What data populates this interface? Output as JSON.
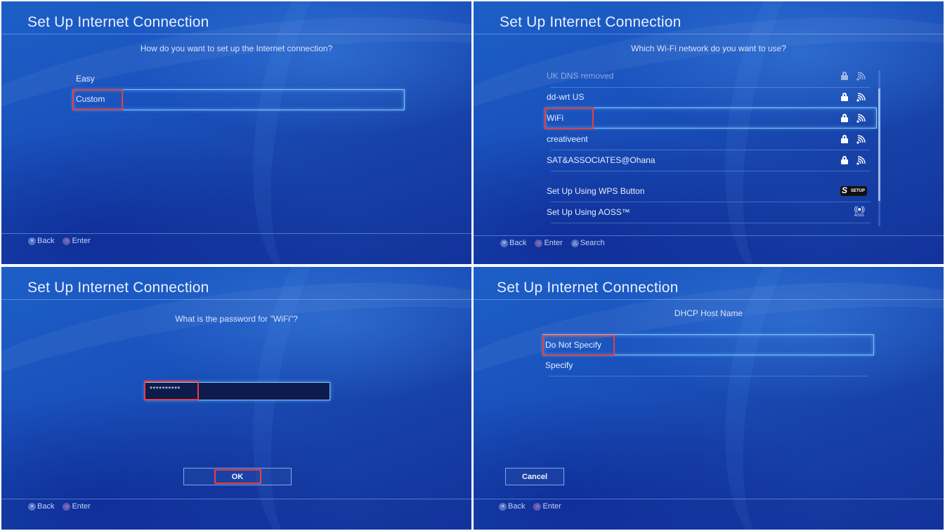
{
  "screens": [
    {
      "title": "Set Up Internet Connection",
      "prompt": "How do you want to set up the Internet connection?",
      "options": [
        {
          "label": "Easy",
          "selected": false
        },
        {
          "label": "Custom",
          "selected": true,
          "highlighted": true
        }
      ],
      "footer": [
        {
          "glyph": "cross-button-icon",
          "label": "Back"
        },
        {
          "glyph": "circle-button-icon",
          "label": "Enter"
        }
      ]
    },
    {
      "title": "Set Up Internet Connection",
      "prompt": "Which Wi-Fi network do you want to use?",
      "networks": [
        {
          "ssid": "UK DNS removed",
          "secured": true,
          "faded": true
        },
        {
          "ssid": "dd-wrt US",
          "secured": true
        },
        {
          "ssid": "WiFi",
          "secured": true,
          "selected": true,
          "highlighted": true
        },
        {
          "ssid": "creativeent",
          "secured": true
        },
        {
          "ssid": "SAT&ASSOCIATES@Ohana",
          "secured": true
        }
      ],
      "setup_options": [
        {
          "label": "Set Up Using WPS Button",
          "icon": "wps-setup-icon",
          "badge": "SETUP"
        },
        {
          "label": "Set Up Using AOSS™",
          "icon": "aoss-icon",
          "badge": "AOSS"
        }
      ],
      "footer": [
        {
          "glyph": "cross-button-icon",
          "label": "Back"
        },
        {
          "glyph": "circle-button-icon",
          "label": "Enter"
        },
        {
          "glyph": "triangle-button-icon",
          "label": "Search"
        }
      ]
    },
    {
      "title": "Set Up Internet Connection",
      "prompt": "What is the password for \"WiFi\"?",
      "password_value": "**********",
      "ok_label": "OK",
      "footer": [
        {
          "glyph": "cross-button-icon",
          "label": "Back"
        },
        {
          "glyph": "circle-button-icon",
          "label": "Enter"
        }
      ]
    },
    {
      "title": "Set Up Internet Connection",
      "prompt": "DHCP Host Name",
      "options": [
        {
          "label": "Do Not Specify",
          "selected": true,
          "highlighted": true
        },
        {
          "label": "Specify",
          "selected": false
        }
      ],
      "cancel_label": "Cancel",
      "footer": [
        {
          "glyph": "cross-button-icon",
          "label": "Back"
        },
        {
          "glyph": "circle-button-icon",
          "label": "Enter"
        }
      ]
    }
  ],
  "colors": {
    "highlight_annotation": "#e8403f",
    "selection_glow": "#7fc4ff",
    "background": "#1a52bd"
  }
}
